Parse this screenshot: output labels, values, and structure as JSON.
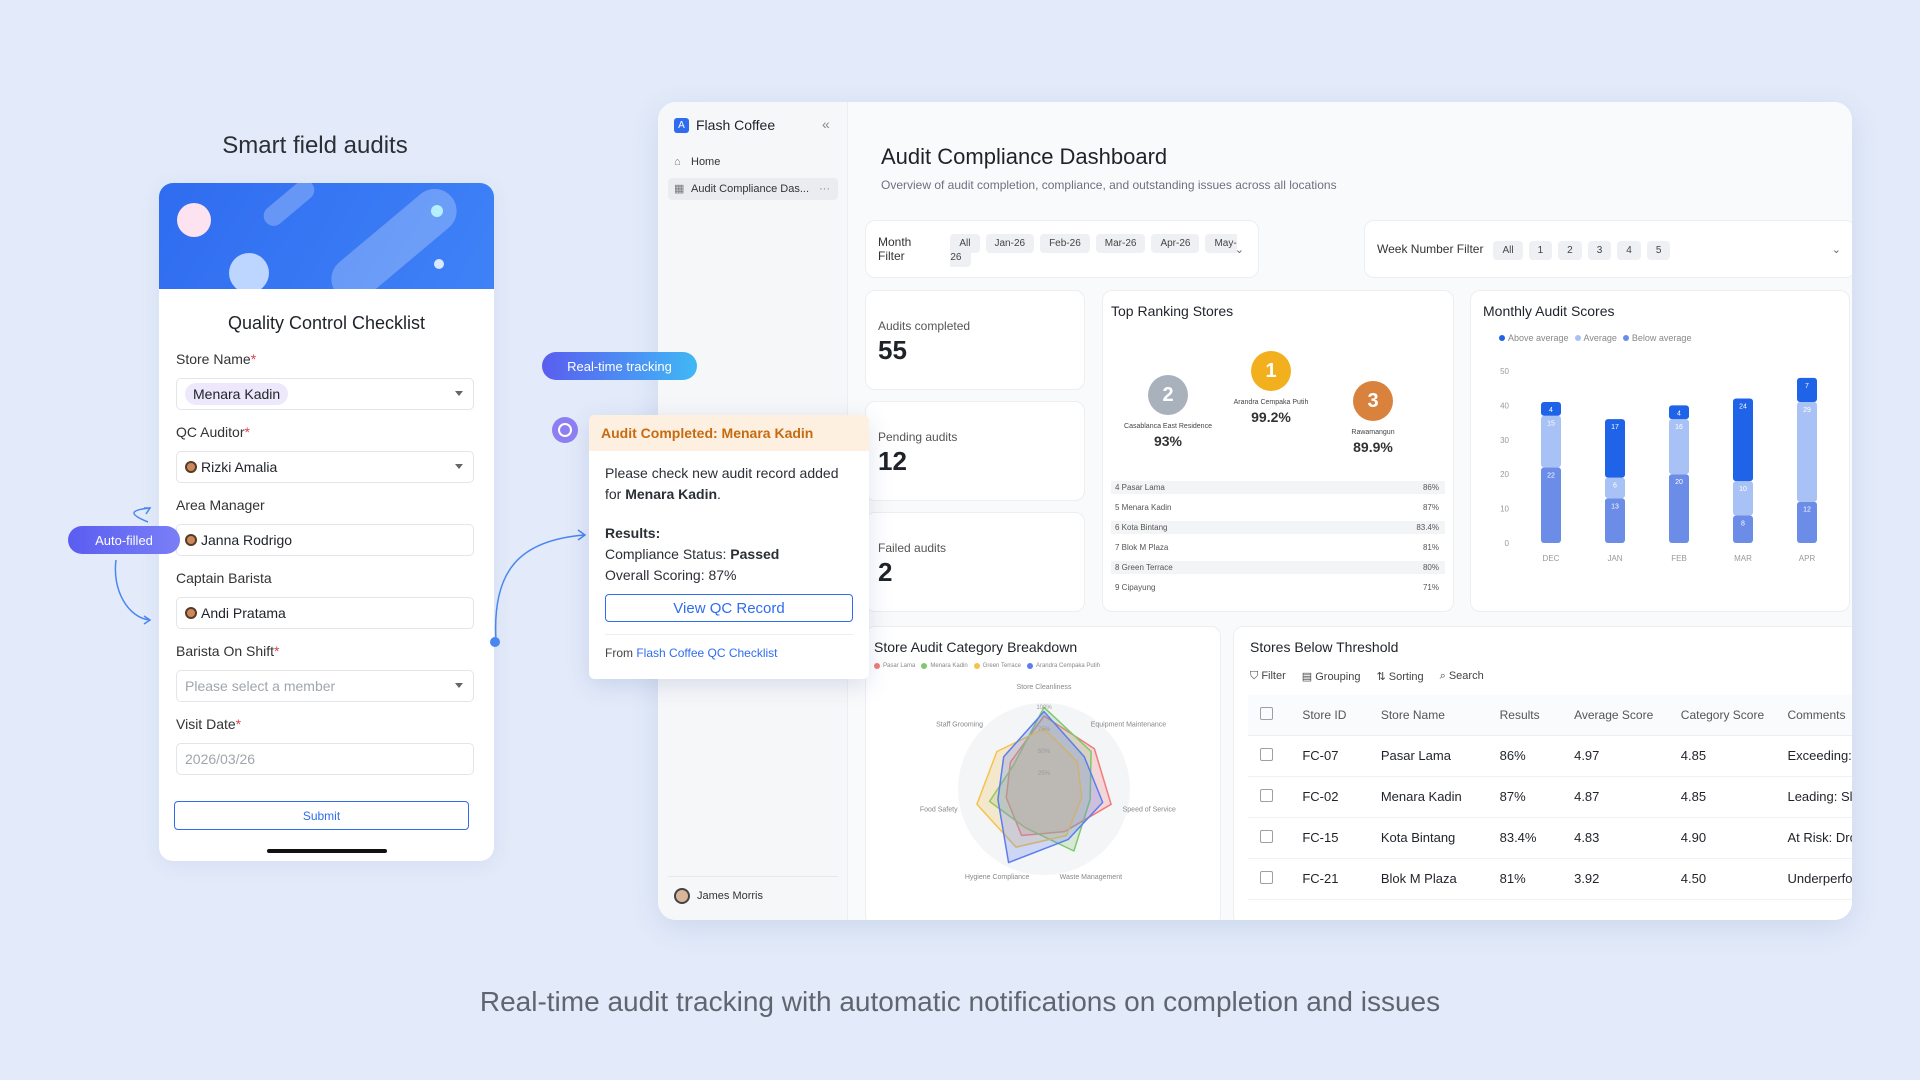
{
  "heading": "Smart field audits",
  "caption": "Real-time audit tracking with automatic notifications on completion and issues",
  "form": {
    "title": "Quality Control Checklist",
    "store_label": "Store Name",
    "store_value": "Menara Kadin",
    "auditor_label": "QC Auditor",
    "auditor_value": "Rizki Amalia",
    "manager_label": "Area Manager",
    "manager_value": "Janna Rodrigo",
    "captain_label": "Captain Barista",
    "captain_value": "Andi Pratama",
    "barista_label": "Barista On Shift",
    "barista_placeholder": "Please select a member",
    "date_label": "Visit Date",
    "date_placeholder": "2026/03/26",
    "submit_label": "Submit",
    "required_mark": "*"
  },
  "pills": {
    "realtime": "Real-time tracking",
    "autofilled": "Auto-filled"
  },
  "notification": {
    "header": "Audit Completed: Menara Kadin",
    "line1": "Please check new audit record added for ",
    "store": "Menara Kadin",
    "line1_end": ".",
    "results_label": "Results:",
    "status_label": "Compliance Status: ",
    "status_value": "Passed",
    "scoring": "Overall Scoring: 87%",
    "button": "View QC Record",
    "from_label": "From ",
    "from_link": "Flash Coffee QC Checklist"
  },
  "sidebar": {
    "brand": "Flash Coffee",
    "collapse": "«",
    "items": [
      {
        "label": "Home"
      },
      {
        "label": "Audit Compliance Das..."
      }
    ],
    "more": "···",
    "user": "James Morris"
  },
  "dashboard": {
    "title": "Audit Compliance Dashboard",
    "subtitle": "Overview of audit completion, compliance, and outstanding issues across all locations",
    "month_filter": {
      "label": "Month Filter",
      "options": [
        "All",
        "Jan-26",
        "Feb-26",
        "Mar-26",
        "Apr-26",
        "May-26"
      ]
    },
    "week_filter": {
      "label": "Week Number Filter",
      "options": [
        "All",
        "1",
        "2",
        "3",
        "4",
        "5"
      ]
    },
    "kpis": [
      {
        "label": "Audits completed",
        "value": "55"
      },
      {
        "label": "Pending audits",
        "value": "12"
      },
      {
        "label": "Failed audits",
        "value": "2"
      }
    ],
    "ranking": {
      "title": "Top Ranking Stores",
      "podium": [
        {
          "rank": "2",
          "name": "Casablanca East Residence",
          "pct": "93%",
          "color": "#a9b1bd"
        },
        {
          "rank": "1",
          "name": "Arandra Cempaka Putih",
          "pct": "99.2%",
          "color": "#f2b01e"
        },
        {
          "rank": "3",
          "name": "Rawamangun",
          "pct": "89.9%",
          "color": "#d9823e"
        }
      ],
      "list": [
        {
          "name": "4  Pasar Lama",
          "value": "86%"
        },
        {
          "name": "5  Menara Kadin",
          "value": "87%"
        },
        {
          "name": "6  Kota Bintang",
          "value": "83.4%"
        },
        {
          "name": "7  Blok M Plaza",
          "value": "81%"
        },
        {
          "name": "8  Green Terrace",
          "value": "80%"
        },
        {
          "name": "9  Cipayung",
          "value": "71%"
        }
      ]
    },
    "category": {
      "title": "Store Audit Category Breakdown",
      "legend": [
        "Pasar Lama",
        "Menara Kadin",
        "Green Terrace",
        "Arandra Cempaka Putih"
      ],
      "axes": [
        "Store Cleanliness",
        "Equipment Maintenance",
        "Speed of Service",
        "Waste Management",
        "Hygiene Compliance",
        "Food Safety",
        "Staff Grooming"
      ],
      "rings": [
        "100%",
        "75%",
        "50%",
        "25%"
      ]
    },
    "threshold": {
      "title": "Stores Below Threshold",
      "tools": [
        "Filter",
        "Grouping",
        "Sorting",
        "Search"
      ],
      "columns": [
        "Store ID",
        "Store Name",
        "Results",
        "Average Score",
        "Category Score",
        "Comments"
      ],
      "rows": [
        [
          "FC-07",
          "Pasar Lama",
          "86%",
          "4.97",
          "4.85",
          "Exceeding:"
        ],
        [
          "FC-02",
          "Menara Kadin",
          "87%",
          "4.87",
          "4.85",
          "Leading: Sl"
        ],
        [
          "FC-15",
          "Kota Bintang",
          "83.4%",
          "4.83",
          "4.90",
          "At Risk: Dro"
        ],
        [
          "FC-21",
          "Blok M Plaza",
          "81%",
          "3.92",
          "4.50",
          "Underperfo"
        ]
      ]
    }
  },
  "chart_data": {
    "type": "bar",
    "title": "Monthly Audit Scores",
    "categories": [
      "DEC",
      "JAN",
      "FEB",
      "MAR",
      "APR"
    ],
    "ylim": [
      0,
      50
    ],
    "yticks": [
      0,
      10,
      20,
      30,
      40,
      50
    ],
    "legend": [
      "Above average",
      "Average",
      "Below average"
    ],
    "legend_placement": "top-left",
    "colors": {
      "Below average": "#6b8de8",
      "Average": "#a9c2f5",
      "Above average": "#1f63e8"
    },
    "series": [
      {
        "name": "Below average",
        "values": [
          22,
          13,
          20,
          8,
          12
        ]
      },
      {
        "name": "Average",
        "values": [
          15,
          6,
          16,
          10,
          29
        ]
      },
      {
        "name": "Above average",
        "values": [
          4,
          17,
          4,
          24,
          7
        ]
      }
    ]
  }
}
